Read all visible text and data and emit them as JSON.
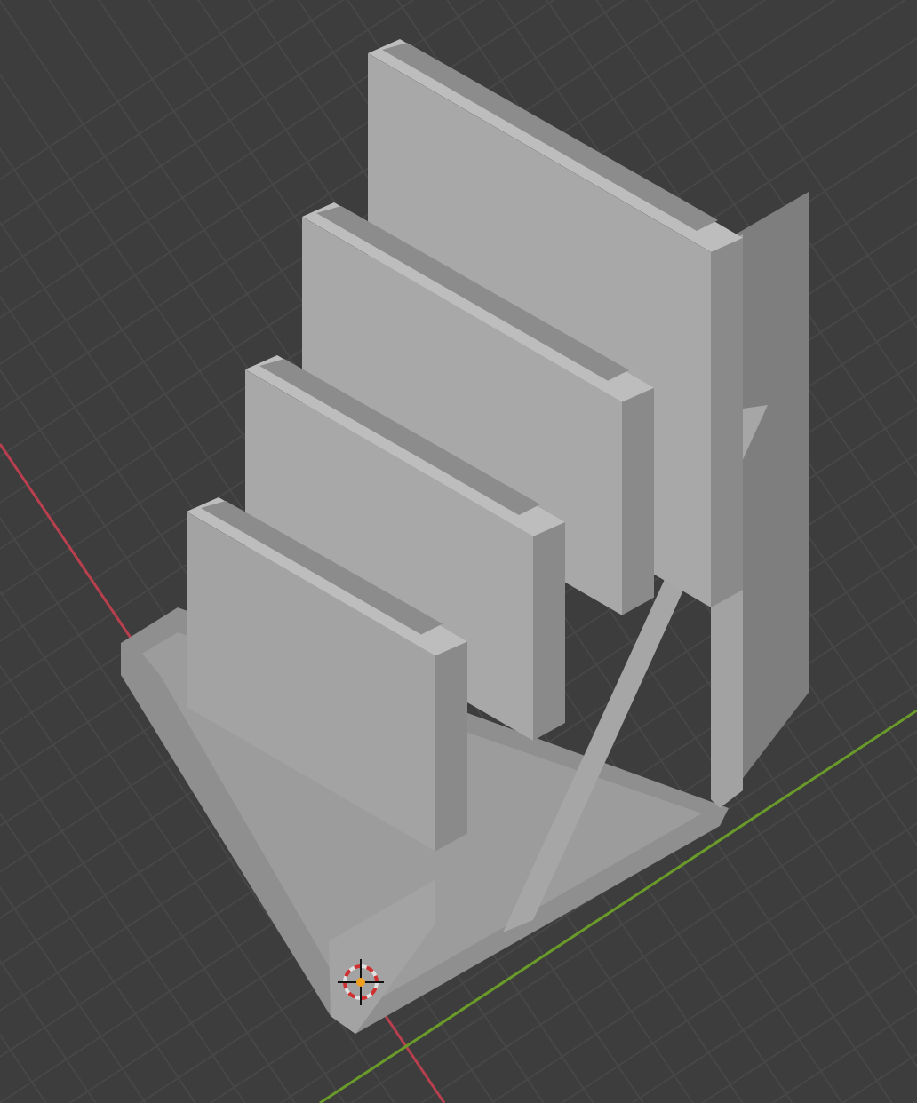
{
  "viewport": {
    "axes": [
      {
        "kind": "x",
        "color": "#b8404e"
      },
      {
        "kind": "y",
        "color": "#6a9a2a"
      }
    ]
  }
}
